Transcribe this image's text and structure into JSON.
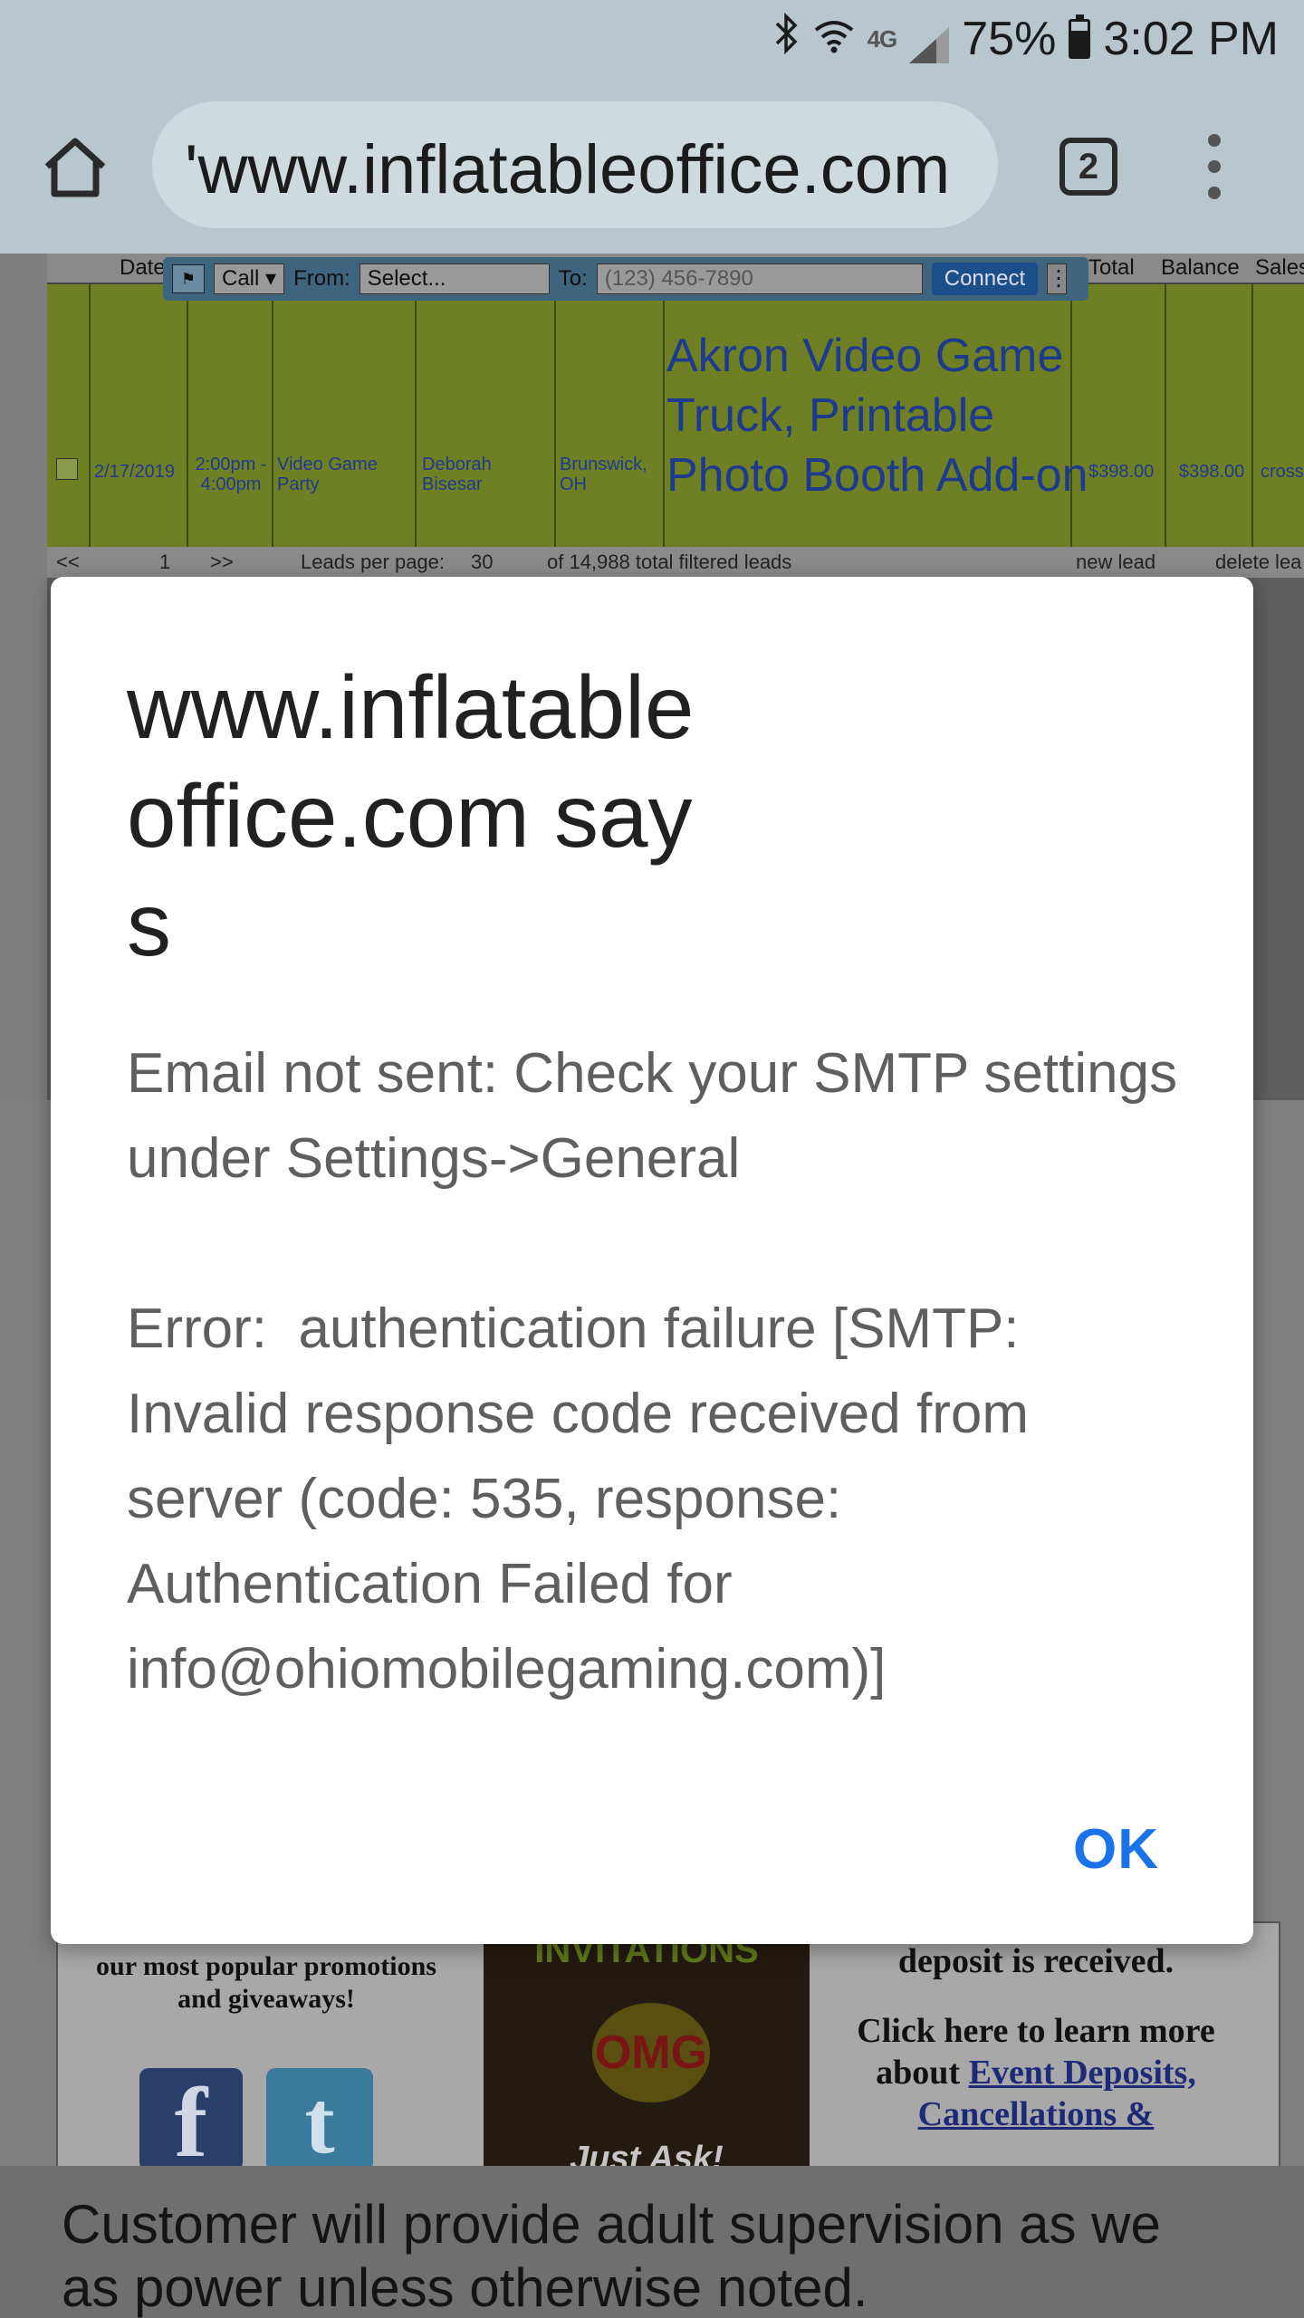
{
  "status_bar": {
    "net_label": "4G",
    "battery": "75%",
    "battery_level": 0.75,
    "time": "3:02 PM"
  },
  "browser": {
    "url": "'www.inflatableoffice.com",
    "tab_count": "2"
  },
  "background_page": {
    "table_headers": [
      "Date",
      "Total",
      "Balance",
      "Sales"
    ],
    "call_bar": {
      "mode": "Call",
      "from_label": "From:",
      "from_value": "Select...",
      "to_label": "To:",
      "to_placeholder": "(123) 456-7890",
      "connect_label": "Connect"
    },
    "row": {
      "date": "2/17/2019",
      "time": "2:00pm - 4:00pm",
      "event": "Video Game Party",
      "name": "Deborah Bisesar",
      "city": "Brunswick, OH",
      "title": "Akron Video Game Truck, Printable Photo Booth Add-on",
      "total": "$398.00",
      "balance": "$398.00",
      "sales": "cross"
    },
    "pager": {
      "page": "1",
      "per_page_label": "Leads per page:",
      "per_page": "30",
      "count_text": "of 14,988 total filtered leads",
      "new_lead": "new lead",
      "delete_lead": "delete lea"
    },
    "promo": {
      "col1_text": "our most popular promotions and giveaways!",
      "invitation_title": "INVITATIONS",
      "invitation_bottom": "Just Ask!",
      "deposit_top": "deposit is received.",
      "col3_text": "Click here to learn more about",
      "col3_link": "Event Deposits, Cancellations &"
    },
    "bottom_text_line1": "Customer will provide adult supervision as we",
    "bottom_text_line2": "as power unless otherwise noted."
  },
  "dialog": {
    "title": "www.inflatableoffice.com says",
    "message": "Email not sent: Check your SMTP settings under Settings->General\n\nError:  authentication failure [SMTP: Invalid response code received from server (code: 535, response: Authentication Failed for info@ohiomobilegaming.com)]",
    "ok_label": "OK"
  }
}
